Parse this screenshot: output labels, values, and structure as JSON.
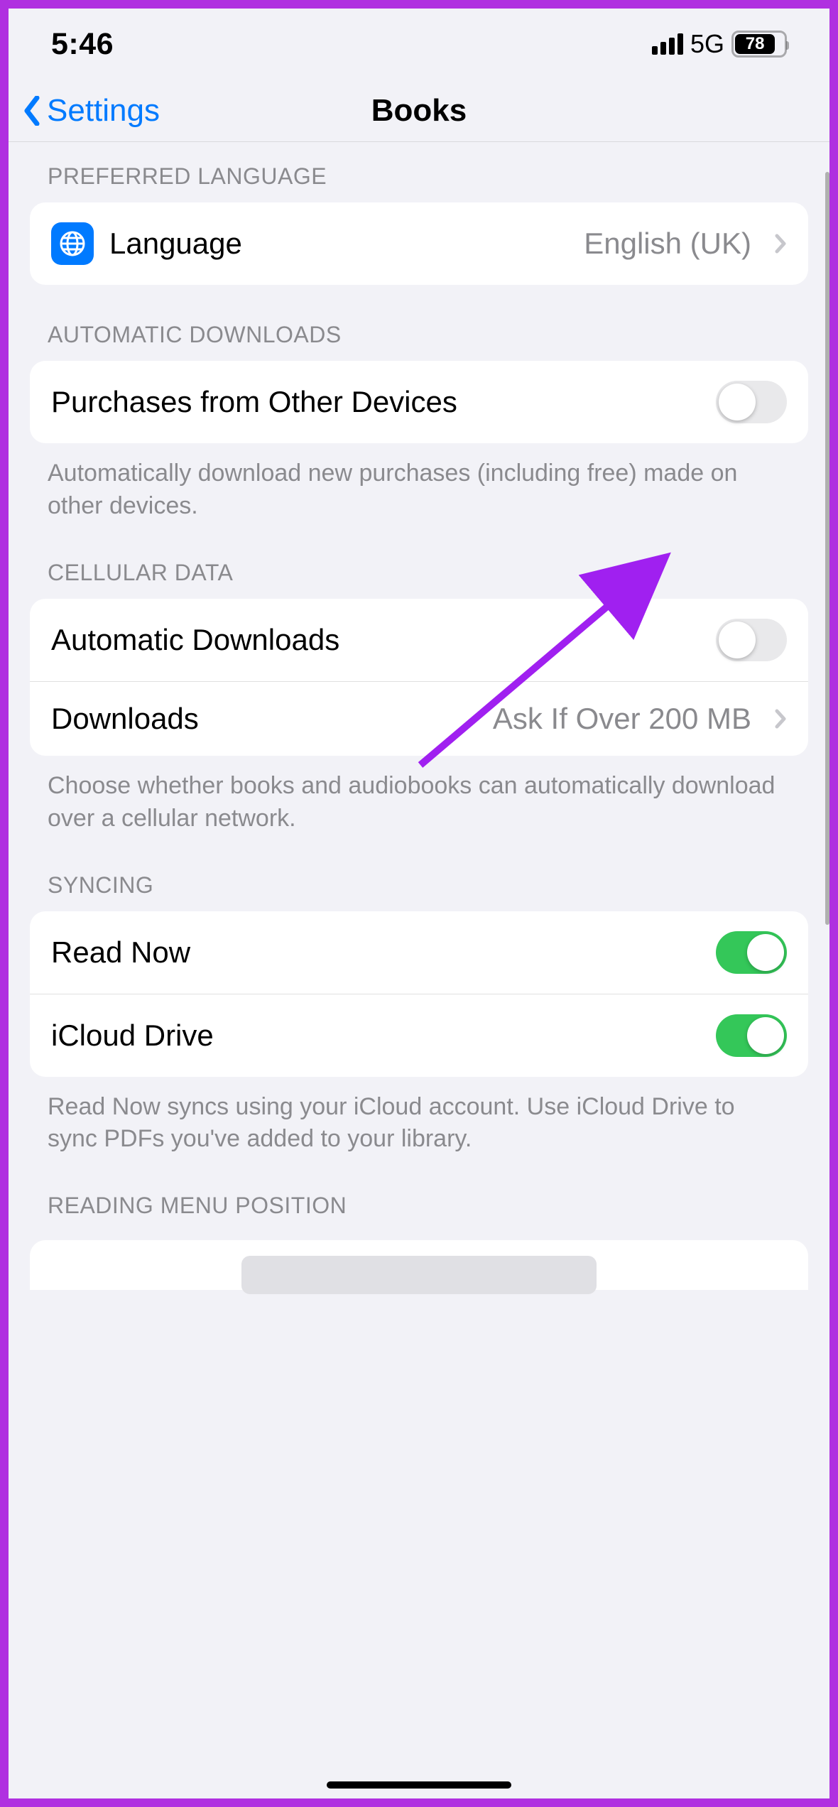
{
  "status": {
    "time": "5:46",
    "network": "5G",
    "battery_pct": "78"
  },
  "nav": {
    "back_label": "Settings",
    "title": "Books"
  },
  "preferred_language": {
    "header": "PREFERRED LANGUAGE",
    "label": "Language",
    "value": "English (UK)"
  },
  "automatic_downloads": {
    "header": "AUTOMATIC DOWNLOADS",
    "purchases_label": "Purchases from Other Devices",
    "purchases_on": false,
    "footer": "Automatically download new purchases (including free) made on other devices."
  },
  "cellular": {
    "header": "CELLULAR DATA",
    "auto_label": "Automatic Downloads",
    "auto_on": false,
    "downloads_label": "Downloads",
    "downloads_value": "Ask If Over 200 MB",
    "footer": "Choose whether books and audiobooks can automatically download over a cellular network."
  },
  "syncing": {
    "header": "SYNCING",
    "read_now_label": "Read Now",
    "read_now_on": true,
    "icloud_label": "iCloud Drive",
    "icloud_on": true,
    "footer": "Read Now syncs using your iCloud account. Use iCloud Drive to sync PDFs you've added to your library."
  },
  "reading_menu": {
    "header": "READING MENU POSITION"
  }
}
